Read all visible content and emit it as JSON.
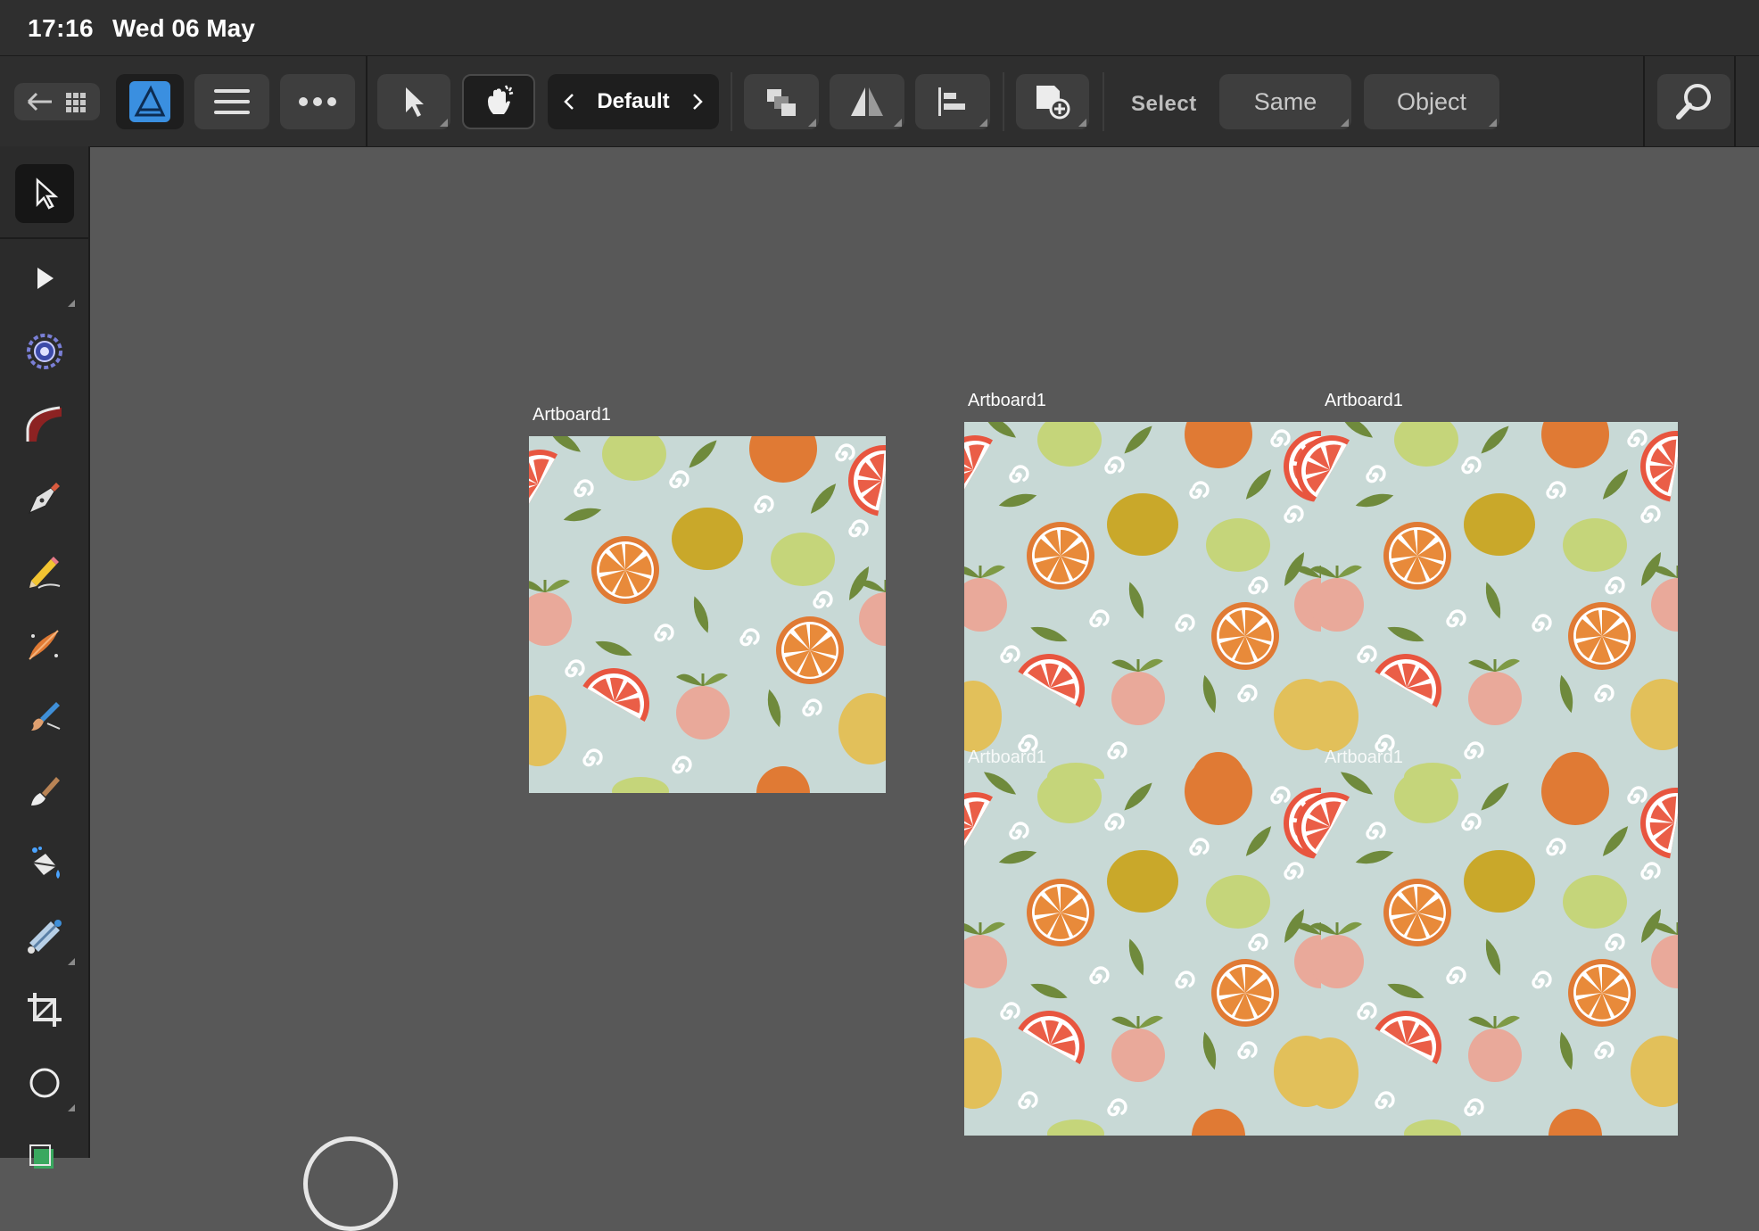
{
  "status_bar": {
    "time": "17:16",
    "date": "Wed 06 May"
  },
  "toolbar": {
    "preset": "Default",
    "select_label": "Select",
    "same_label": "Same",
    "object_label": "Object",
    "icons": [
      "back-arrow-icon",
      "grid-icon",
      "affinity-designer-icon",
      "hamburger-menu-icon",
      "more-icon",
      "move-tool-icon",
      "snapping-icon",
      "chevron-left-icon",
      "chevron-right-icon",
      "arrange-icon",
      "flip-icon",
      "align-icon",
      "insert-icon",
      "zoom-icon"
    ]
  },
  "tools": [
    "move-tool",
    "node-tool",
    "contour-tool",
    "corner-tool",
    "pen-tool",
    "pencil-tool",
    "vector-brush-tool",
    "pixel-brush-tool",
    "fill-tool",
    "transparency-tool",
    "crop-tool",
    "shape-ellipse-tool",
    "artboard-tool"
  ],
  "canvas": {
    "artboards": [
      {
        "label": "Artboard1"
      },
      {
        "label": "Artboard1"
      },
      {
        "label": "Artboard1"
      },
      {
        "label": "Artboard1"
      },
      {
        "label": "Artboard1"
      }
    ],
    "pattern": "citrus fruit pattern (oranges, lemons, limes, grapefruit slices, peaches, leaves, swirls)"
  },
  "colors": {
    "app_bg": "#585858",
    "toolbar_bg": "#2e2e2e",
    "pattern_bg": "#c8d9d6",
    "orange": "#e07a34",
    "lemon": "#c9a82a",
    "lime": "#c5d57a",
    "grapefruit": "#e8553f",
    "peach": "#e9a99a",
    "leaf": "#6f8a3c",
    "swirl": "#ffffff"
  }
}
